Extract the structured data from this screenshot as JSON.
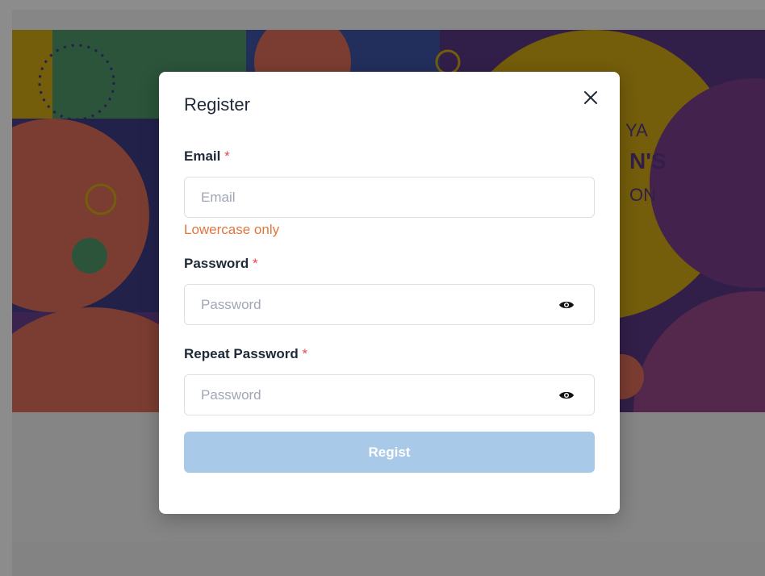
{
  "banner": {
    "partial_text": [
      "YA",
      "N'S",
      "ON"
    ],
    "colors": {
      "yellow": "#d4a914",
      "coral": "#e0705a",
      "green": "#4f9a6a",
      "purple": "#5b3a86",
      "navy": "#3f3c88"
    }
  },
  "modal": {
    "title": "Register",
    "close_icon": "close-icon",
    "email": {
      "label": "Email",
      "required_mark": "*",
      "placeholder": "Email",
      "value": "",
      "hint": "Lowercase only"
    },
    "password": {
      "label": "Password",
      "required_mark": "*",
      "placeholder": "Password",
      "value": "",
      "toggle_icon": "eye-icon"
    },
    "repeat_password": {
      "label": "Repeat Password",
      "required_mark": "*",
      "placeholder": "Password",
      "value": "",
      "toggle_icon": "eye-icon"
    },
    "submit_label": "Regist"
  },
  "colors": {
    "overlay": "rgba(0,0,0,0.45)",
    "hint": "#e0763e",
    "required": "#e5484d",
    "submit_disabled": "#a9c9e8"
  }
}
